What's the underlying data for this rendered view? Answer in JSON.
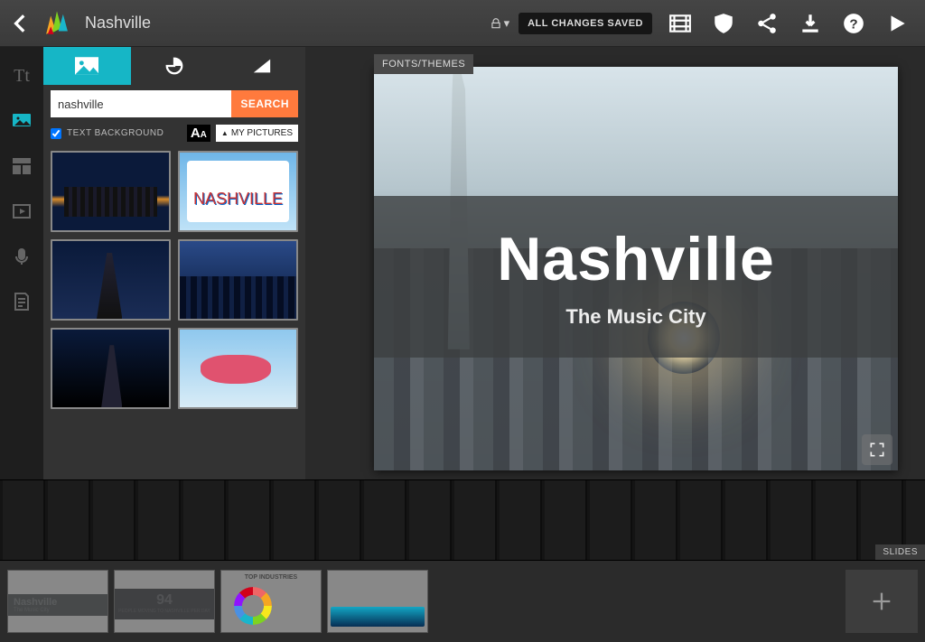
{
  "header": {
    "title": "Nashville",
    "save_status": "ALL CHANGES SAVED"
  },
  "panel": {
    "search_value": "nashville",
    "search_button": "SEARCH",
    "text_bg_label": "TEXT BACKGROUND",
    "my_pictures_label": "MY PICTURES"
  },
  "canvas": {
    "fonts_tag": "FONTS/THEMES",
    "slide_title": "Nashville",
    "slide_subtitle": "The Music City"
  },
  "wood": {
    "slides_label": "SLIDES"
  },
  "tray": {
    "s1_title": "Nashville",
    "s1_sub": "The Music City",
    "s2_num": "94",
    "s2_cap": "PEOPLE MOVING TO NASHVILLE PER DAY",
    "s3_title": "TOP INDUSTRIES"
  }
}
